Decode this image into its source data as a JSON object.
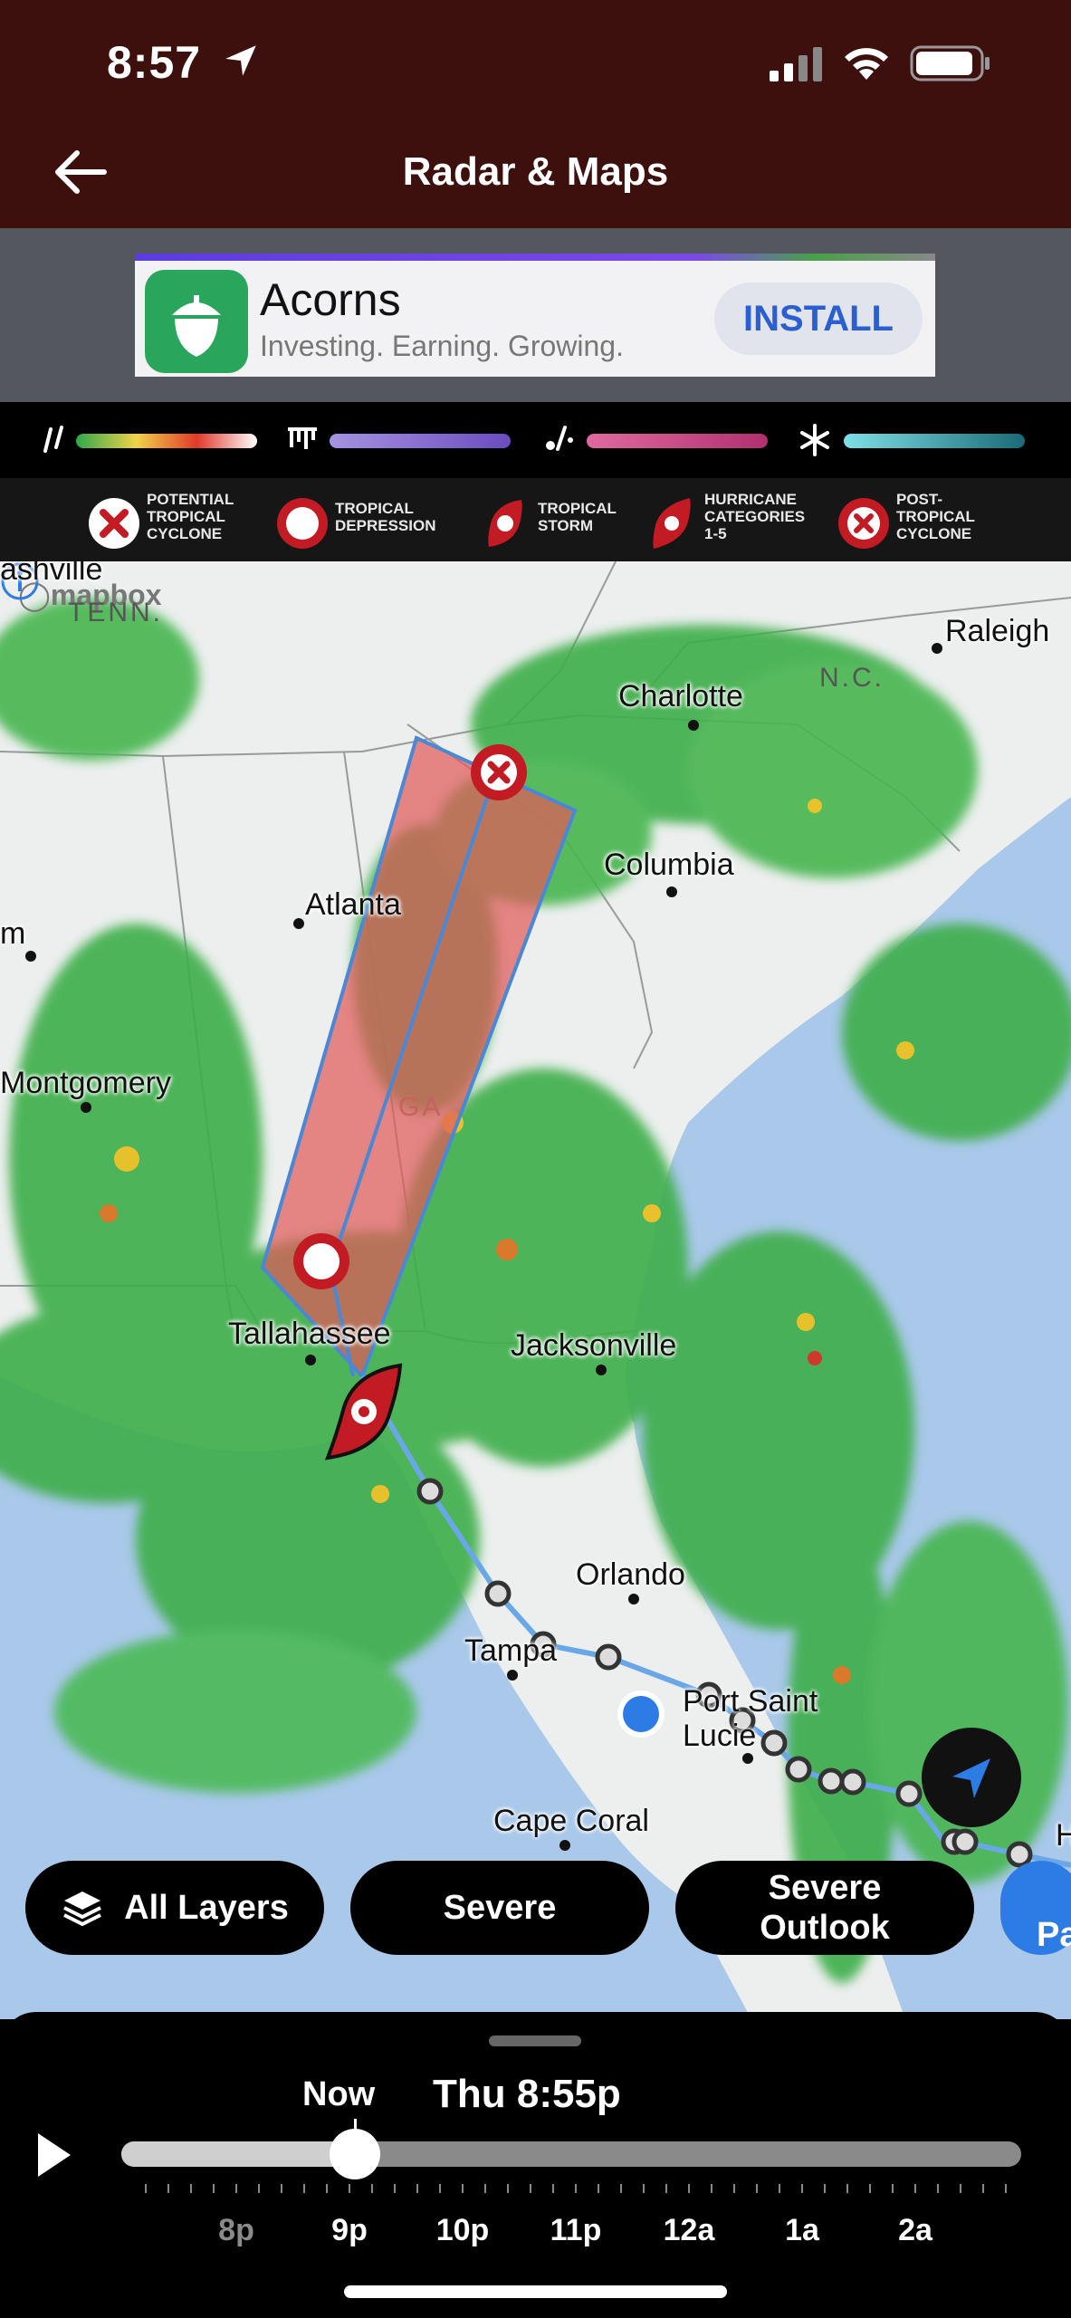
{
  "status_bar": {
    "time": "8:57"
  },
  "header": {
    "title": "Radar & Maps"
  },
  "ad": {
    "app_name": "Acorns",
    "tagline": "Investing. Earning. Growing.",
    "install_label": "INSTALL"
  },
  "storm_legend": [
    {
      "label": "POTENTIAL\nTROPICAL\nCYCLONE",
      "icon": "potential-tropical-cyclone-icon"
    },
    {
      "label": "TROPICAL\nDEPRESSION",
      "icon": "tropical-depression-icon"
    },
    {
      "label": "TROPICAL\nSTORM",
      "icon": "tropical-storm-icon"
    },
    {
      "label": "HURRICANE\nCATEGORIES\n1-5",
      "icon": "hurricane-icon"
    },
    {
      "label": "POST-\nTROPICAL\nCYCLONE",
      "icon": "post-tropical-cyclone-icon"
    }
  ],
  "map": {
    "attribution": "mapbox",
    "cities": {
      "nashville": "ashville",
      "raleigh": "Raleigh",
      "charlotte": "Charlotte",
      "columbia": "Columbia",
      "atlanta": "Atlanta",
      "birmingham": "m",
      "montgomery": "Montgomery",
      "tallahassee": "Tallahassee",
      "jacksonville": "Jacksonville",
      "orlando": "Orlando",
      "tampa": "Tampa",
      "port_saint_lucie": "Port Saint\nLucie",
      "cape_coral": "Cape Coral"
    },
    "states": {
      "tenn": "TENN.",
      "nc": "N.C.",
      "ga": "GA"
    }
  },
  "chips": {
    "all_layers": "All Layers",
    "severe": "Severe",
    "severe_outlook": "Severe\nOutlook",
    "partial": "Pa"
  },
  "timeline": {
    "now_label": "Now",
    "current_time": "Thu 8:55p",
    "hours": [
      "8p",
      "9p",
      "10p",
      "11p",
      "12a",
      "1a",
      "2a"
    ],
    "position_fraction": 0.26
  },
  "colors": {
    "header_bg": "#3d0f0d",
    "accent_blue": "#2d7be5",
    "cone_red": "#e05a5a"
  }
}
